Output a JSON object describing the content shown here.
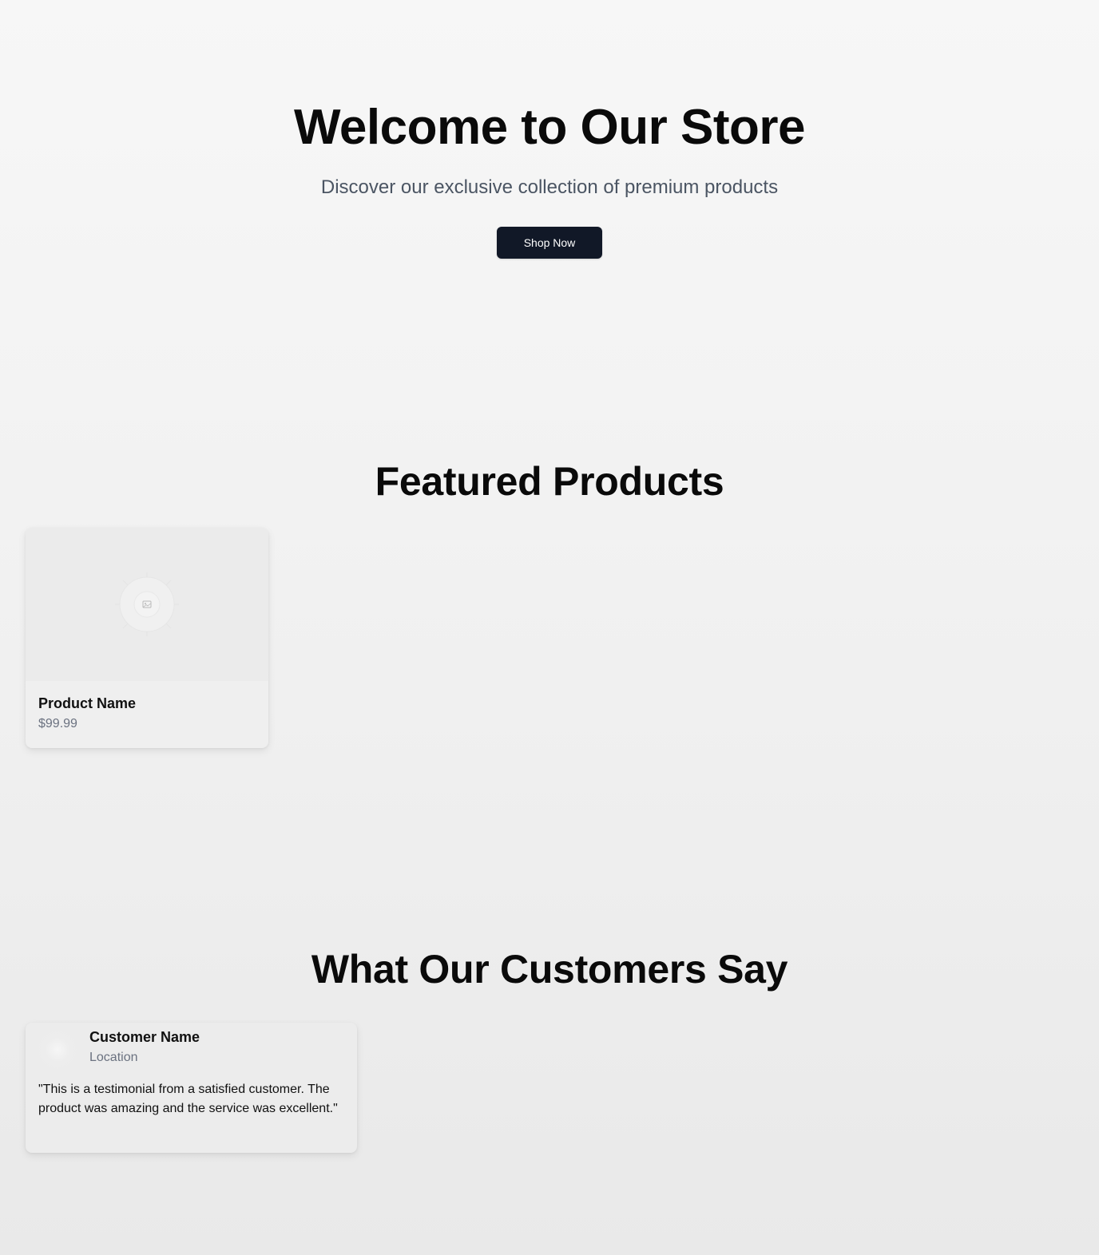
{
  "hero": {
    "title": "Welcome to Our Store",
    "subtitle": "Discover our exclusive collection of premium products",
    "cta_label": "Shop Now"
  },
  "featured": {
    "title": "Featured Products",
    "products": [
      {
        "name": "Product Name",
        "price": "$99.99",
        "image_icon": "image-placeholder-icon"
      }
    ]
  },
  "testimonials": {
    "title": "What Our Customers Say",
    "items": [
      {
        "name": "Customer Name",
        "location": "Location",
        "quote": "\"This is a testimonial from a satisfied customer. The product was amazing and the service was excellent.\"",
        "avatar_icon": "avatar-placeholder"
      }
    ]
  },
  "colors": {
    "primary_button": "#111827",
    "muted_text": "#6b7280",
    "subtitle_text": "#4b5563"
  }
}
